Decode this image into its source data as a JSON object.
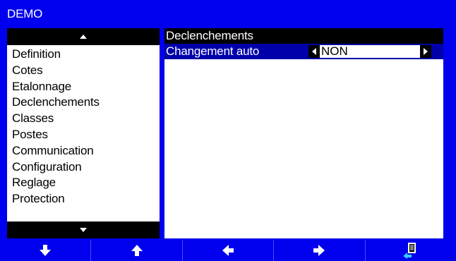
{
  "window": {
    "title": "DEMO"
  },
  "menu": {
    "items": [
      "Definition",
      "Cotes",
      "Etalonnage",
      "Declenchements",
      "Classes",
      "Postes",
      "Communication",
      "Configuration",
      "Reglage",
      "Protection"
    ],
    "selected_index": 3
  },
  "detail": {
    "header": "Declenchements",
    "params": [
      {
        "label": "Changement  auto",
        "value": "NON"
      }
    ]
  },
  "softkeys": [
    {
      "icon": "arrow-down-icon"
    },
    {
      "icon": "arrow-up-icon"
    },
    {
      "icon": "arrow-left-icon"
    },
    {
      "icon": "arrow-right-icon"
    },
    {
      "icon": "document-enter-icon"
    }
  ],
  "colors": {
    "background": "#0000ee",
    "panel": "#ffffff",
    "header_bar": "#000000",
    "selected_row": "#0000aa",
    "text_on_dark": "#ffffff"
  }
}
